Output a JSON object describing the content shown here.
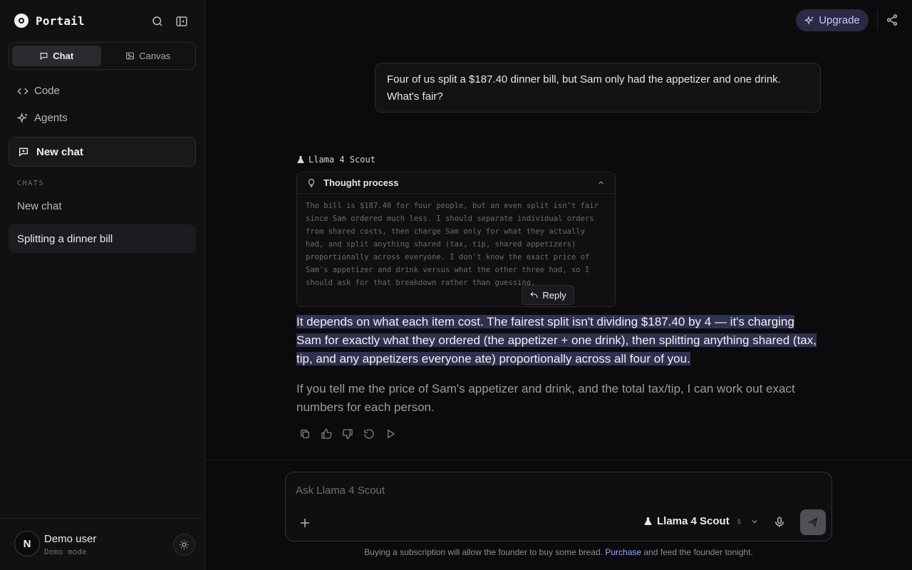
{
  "app": {
    "name": "Portail"
  },
  "sidebar": {
    "mode_tabs": [
      {
        "label": "Chat",
        "icon": "chat-bubble-icon",
        "active": true
      },
      {
        "label": "Canvas",
        "icon": "image-icon",
        "active": false
      }
    ],
    "nav": [
      {
        "label": "Code",
        "icon": "code-icon"
      },
      {
        "label": "Agents",
        "icon": "sparkle-icon"
      }
    ],
    "new_chat_label": "New chat",
    "section_label": "CHATS",
    "chats": [
      {
        "label": "New chat",
        "active": false
      },
      {
        "label": "Splitting a dinner bill",
        "active": true
      }
    ],
    "user": {
      "initial": "N",
      "name": "Demo user",
      "subtitle": "Demo mode"
    }
  },
  "header": {
    "upgrade_label": "Upgrade"
  },
  "conversation": {
    "user_message": "Four of us split a $187.40 dinner bill, but Sam only had the appetizer and one drink. What's fair?",
    "model_name": "Llama 4 Scout",
    "thought": {
      "title": "Thought process",
      "text": "The bill is $187.40 for four people, but an even split isn't fair since Sam ordered much less. I should separate individual orders from shared costs, then charge Sam only for what they actually had, and split anything shared (tax, tip, shared appetizers) proportionally across everyone. I don't know the exact price of Sam's appetizer and drink versus what the other three had, so I should ask for that breakdown rather than guessing."
    },
    "reply_label": "Reply",
    "answer_highlighted": "It depends on what each item cost. The fairest split isn't dividing $187.40 by 4 — it's charging Sam for exactly what they ordered (the appetizer + one drink), then splitting anything shared (tax, tip, and any appetizers everyone ate) proportionally across all four of you.",
    "answer_followup": "If you tell me the price of Sam's appetizer and drink, and the total tax/tip, I can work out exact numbers for each person."
  },
  "composer": {
    "placeholder": "Ask Llama 4 Scout",
    "model_label": "Llama 4 Scout",
    "model_tag": "$"
  },
  "footer": {
    "text_before": "Buying a subscription will allow the founder to buy some bread. ",
    "link": "Purchase",
    "text_after": " and feed the founder tonight."
  },
  "colors": {
    "accent": "#9aa1ff",
    "highlight": "#2f3150",
    "background": "#0b0b0d"
  }
}
